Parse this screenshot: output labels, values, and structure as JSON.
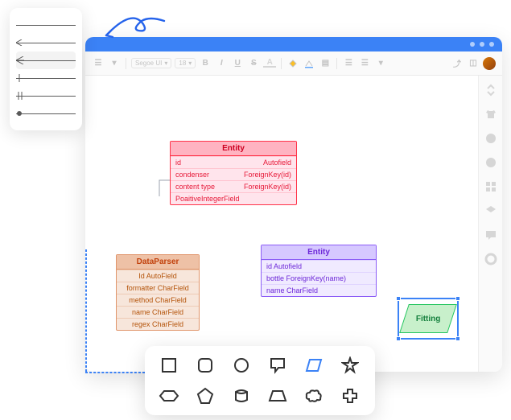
{
  "arrowStyles": [
    "none",
    "arrow",
    "arrow-plus",
    "bar",
    "double-bar",
    "circle"
  ],
  "toolbar": {
    "font": "Segoe UI",
    "size": "18",
    "bold": "B",
    "italic": "I",
    "underline": "U",
    "strike": "S"
  },
  "entities": {
    "pink": {
      "title": "Entity",
      "rows": [
        {
          "a": "id",
          "b": "Autofield"
        },
        {
          "a": "condenser",
          "b": "ForeignKey(id)"
        },
        {
          "a": "content type",
          "b": "ForeignKey(id)"
        },
        {
          "a": "PoaitiveIntegerField",
          "b": ""
        }
      ]
    },
    "brown": {
      "title": "DataParser",
      "rows": [
        "Id AutoField",
        "formatter CharField",
        "method CharField",
        "name CharField",
        "regex CharField"
      ]
    },
    "purple": {
      "title": "Entity",
      "rows": [
        {
          "a": "id Autofield",
          "b": ""
        },
        {
          "a": "bottle ForeignKey(name)",
          "b": ""
        },
        {
          "a": "name CharField",
          "b": ""
        }
      ]
    }
  },
  "fitting": {
    "label": "Fitting"
  },
  "shapes": [
    "square",
    "rounded",
    "circle",
    "callout",
    "parallelogram",
    "star",
    "hex-arrow",
    "pentagon",
    "barrel",
    "trapezoid",
    "cloud",
    "plus"
  ]
}
